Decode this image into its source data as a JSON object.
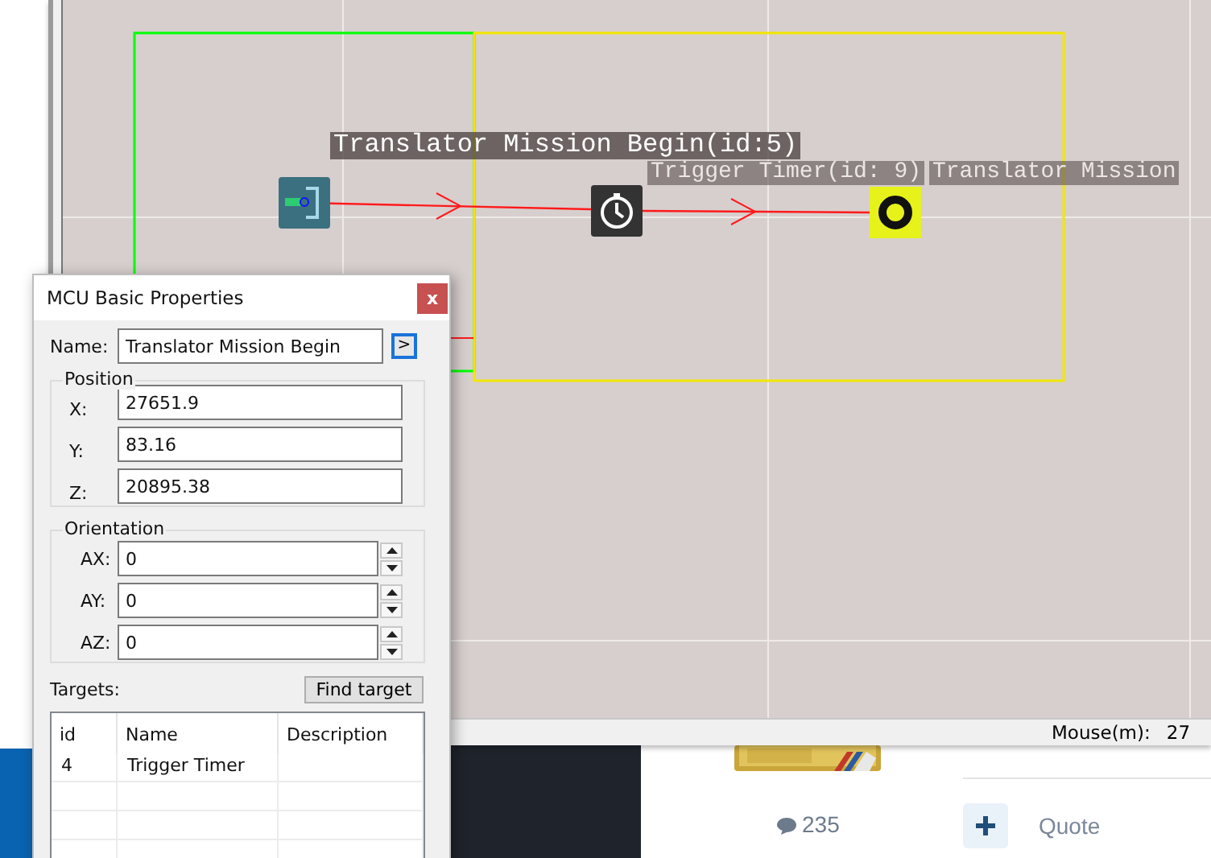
{
  "editor": {
    "canvas": {
      "regions": [
        {
          "color": "#00ff00"
        },
        {
          "color": "#f2e600"
        }
      ],
      "nodes": [
        {
          "kind": "entry",
          "label": "Translator Mission Begin(id:5)",
          "selected": true
        },
        {
          "kind": "timer",
          "label": "Trigger Timer(id: 9)",
          "selected": false
        },
        {
          "kind": "target",
          "label": "Translator Mission",
          "selected": false
        }
      ]
    },
    "status_bar": {
      "label": "Mouse(m):",
      "value": "27"
    }
  },
  "dialog": {
    "title": "MCU Basic Properties",
    "close": "x",
    "name": {
      "label": "Name:",
      "value": "Translator Mission Begin",
      "button": ">"
    },
    "position": {
      "title": "Position",
      "fields": [
        {
          "label": "X:",
          "value": "27651.9"
        },
        {
          "label": "Y:",
          "value": "83.16"
        },
        {
          "label": "Z:",
          "value": "20895.38"
        }
      ]
    },
    "orientation": {
      "title": "Orientation",
      "fields": [
        {
          "label": "AX:",
          "value": "0"
        },
        {
          "label": "AY:",
          "value": "0"
        },
        {
          "label": "AZ:",
          "value": "0"
        }
      ]
    },
    "targets": {
      "label": "Targets:",
      "button": "Find target",
      "columns": [
        "id",
        "Name",
        "Description"
      ],
      "rows": [
        [
          "4",
          "Trigger Timer",
          ""
        ]
      ]
    }
  },
  "background_page": {
    "comment_count": "235",
    "quote": "Quote"
  }
}
